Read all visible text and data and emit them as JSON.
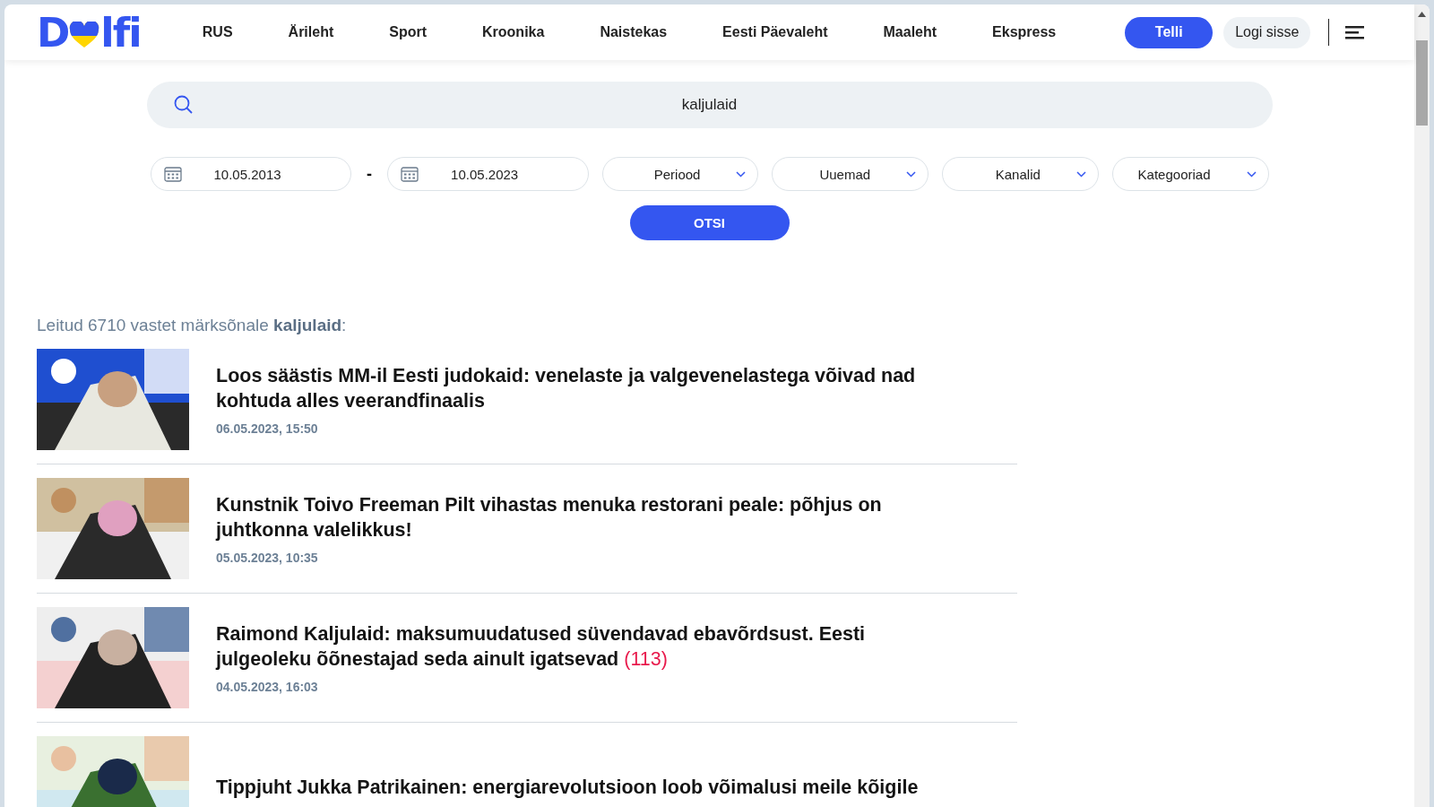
{
  "logo": {
    "left": "D",
    "right": "lfi"
  },
  "nav": [
    "RUS",
    "Ärileht",
    "Sport",
    "Kroonika",
    "Naistekas",
    "Eesti Päevaleht",
    "Maaleht",
    "Ekspress"
  ],
  "header_buttons": [
    {
      "label": "Telli",
      "kind": "primary"
    },
    {
      "label": "Logi sisse",
      "kind": "secondary"
    }
  ],
  "search": {
    "value": "kaljulaid"
  },
  "dates": [
    {
      "value": "10.05.2013"
    },
    {
      "value": "10.05.2023"
    }
  ],
  "date_separator": "-",
  "dropdowns": [
    "Periood",
    "Uuemad",
    "Kanalid",
    "Kategooriad"
  ],
  "submit": "OTSI",
  "summary": "Leitud 6710 vastet märksõnale **kaljulaid**:",
  "results": [
    {
      "title": "Loos säästis MM-il Eesti judokaid: venelaste ja valgevenelastega võivad nad kohtuda alles veerandfinaalis",
      "date": "06.05.2023, 15:50",
      "kind": "picture"
    },
    {
      "title": "Kunstnik Toivo Freeman Pilt vihastas menuka restorani peale: põhjus on juhtkonna valelikkus!",
      "date": "05.05.2023, 10:35",
      "kind": "picture"
    },
    {
      "title": "Raimond Kaljulaid: maksumuudatused süvendavad ebavõrdsust. Eesti julgeoleku õõnestajad seda ainult igatsevad",
      "comments": "(113)",
      "date": "04.05.2023, 16:03",
      "kind": "picture"
    },
    {
      "title": "Tippjuht Jukka Patrikainen: energiarevolutsioon loob võimalusi meile kõigile",
      "kind": "picture"
    }
  ]
}
